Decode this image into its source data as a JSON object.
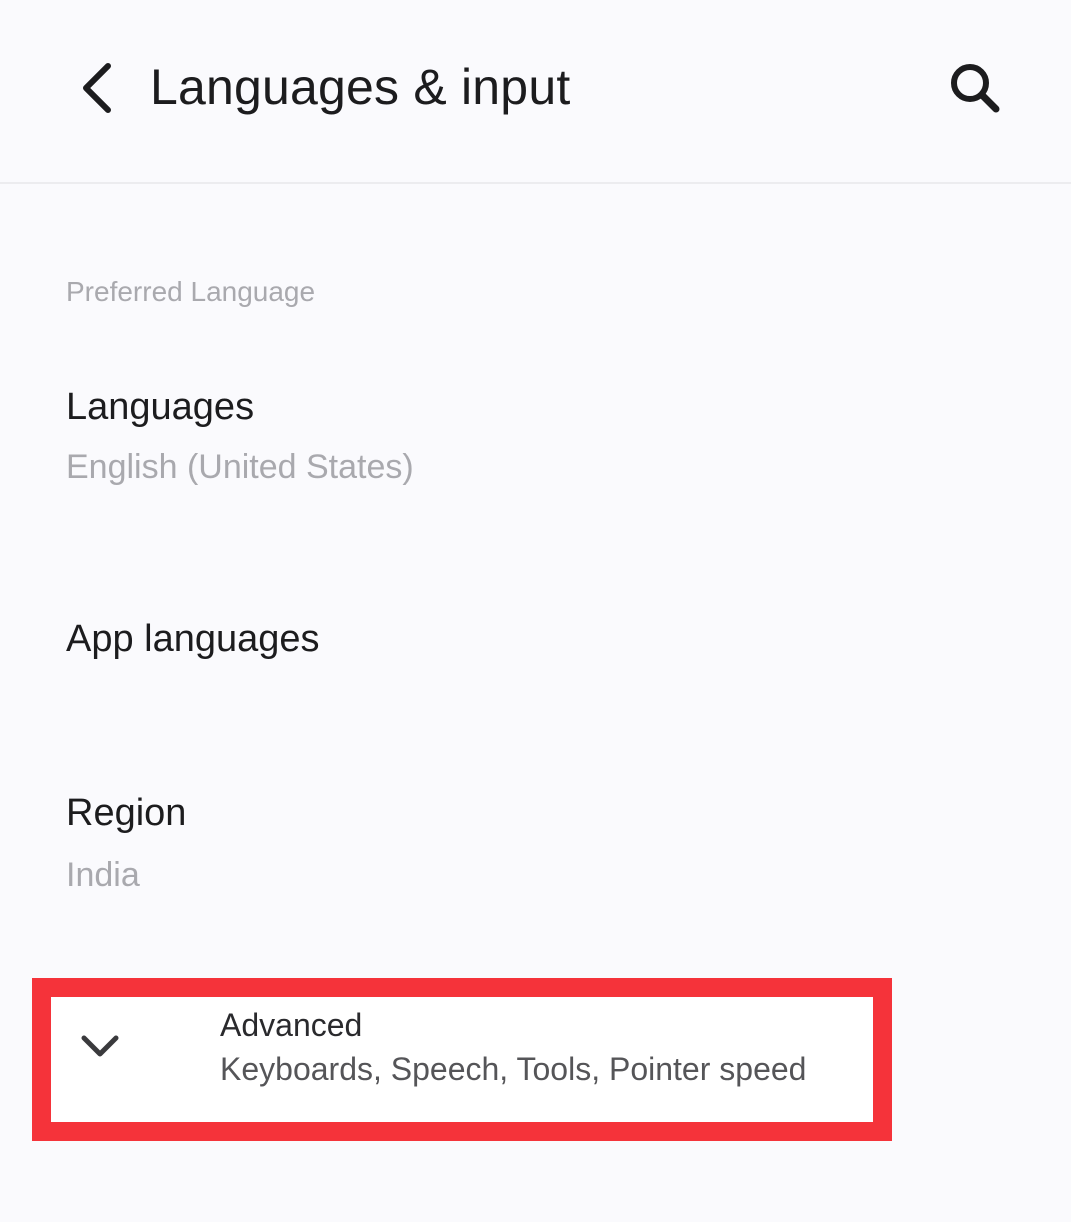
{
  "header": {
    "title": "Languages & input",
    "back_icon": "back-arrow-icon",
    "search_icon": "search-icon"
  },
  "section": {
    "preferred_language_header": "Preferred Language"
  },
  "items": {
    "languages": {
      "title": "Languages",
      "summary": "English (United States)"
    },
    "app_languages": {
      "title": "App languages"
    },
    "region": {
      "title": "Region",
      "summary": "India"
    },
    "advanced": {
      "title": "Advanced",
      "summary": "Keyboards, Speech, Tools, Pointer speed",
      "icon": "chevron-down-icon"
    }
  },
  "colors": {
    "background": "#fafafd",
    "highlight": "#f5333a",
    "secondary_text": "#a9a9ae",
    "primary_text": "#1c1c1e"
  }
}
